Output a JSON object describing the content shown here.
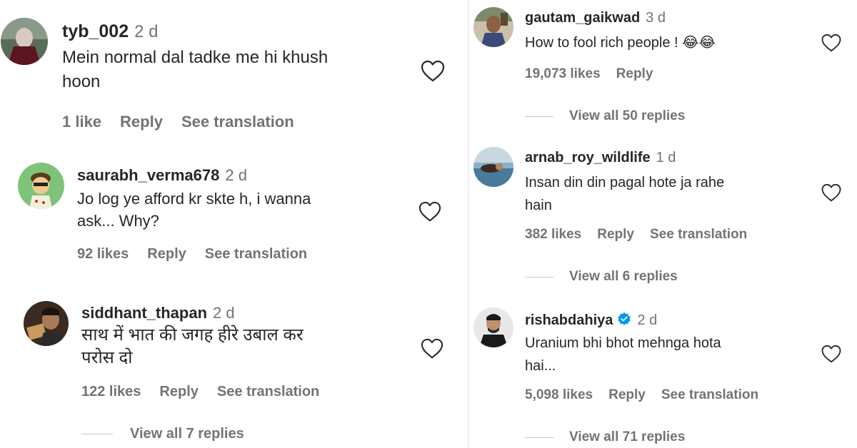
{
  "left_comments": [
    {
      "username": "tyb_002",
      "time": "2 d",
      "text_lines": [
        "Mein normal dal tadke me hi khush",
        "hoon"
      ],
      "likes": "1 like",
      "reply_label": "Reply",
      "translation_label": "See translation",
      "avatar_icon": "avatar-photo-icon"
    },
    {
      "username": "saurabh_verma678",
      "time": "2 d",
      "text_lines": [
        "Jo log ye afford kr skte h, i wanna",
        "ask... Why?"
      ],
      "likes": "92 likes",
      "reply_label": "Reply",
      "translation_label": "See translation",
      "avatar_icon": "avatar-cartoon-icon"
    },
    {
      "username": "siddhant_thapan",
      "time": "2 d",
      "text_lines": [
        "साथ में भात की जगह हीरे उबाल कर",
        "परोस दो"
      ],
      "likes": "122 likes",
      "reply_label": "Reply",
      "translation_label": "See translation",
      "view_replies": "View all 7 replies",
      "avatar_icon": "avatar-photo-icon"
    }
  ],
  "right_comments": [
    {
      "username": "gautam_gaikwad",
      "time": "3 d",
      "text_lines": [
        "How to fool rich people ! 😂😂"
      ],
      "likes": "19,073 likes",
      "reply_label": "Reply",
      "view_replies": "View all 50 replies",
      "avatar_icon": "avatar-photo-icon"
    },
    {
      "username": "arnab_roy_wildlife",
      "time": "1 d",
      "text_lines": [
        "Insan din din pagal hote ja rahe",
        "hain"
      ],
      "likes": "382 likes",
      "reply_label": "Reply",
      "translation_label": "See translation",
      "view_replies": "View all 6 replies",
      "avatar_icon": "avatar-photo-icon"
    },
    {
      "username": "rishabdahiya",
      "time": "2 d",
      "verified": true,
      "text_lines": [
        "Uranium bhi bhot mehnga hota",
        "hai..."
      ],
      "likes": "5,098 likes",
      "reply_label": "Reply",
      "translation_label": "See translation",
      "view_replies": "View all 71 replies",
      "avatar_icon": "avatar-photo-icon"
    }
  ],
  "icons": {
    "like": "heart-outline-icon",
    "verified": "verified-badge-icon"
  },
  "colors": {
    "text": "#262626",
    "secondary": "#737373",
    "verified": "#0095f6",
    "divider": "#c7c7c7"
  }
}
